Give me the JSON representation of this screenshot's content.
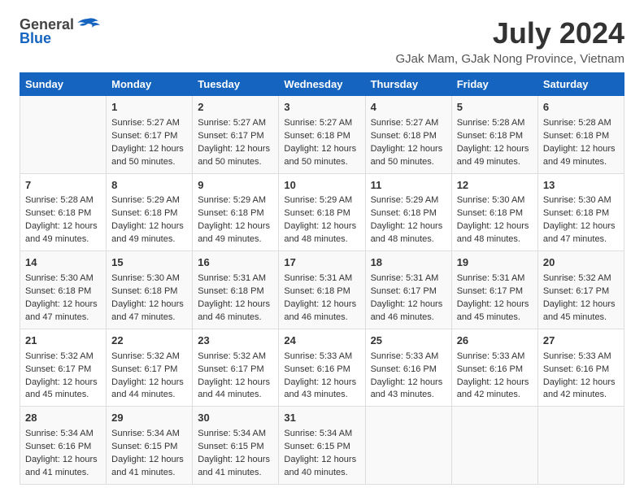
{
  "logo": {
    "general": "General",
    "blue": "Blue"
  },
  "title": "July 2024",
  "subtitle": "GJak Mam, GJak Nong Province, Vietnam",
  "columns": [
    "Sunday",
    "Monday",
    "Tuesday",
    "Wednesday",
    "Thursday",
    "Friday",
    "Saturday"
  ],
  "weeks": [
    [
      {
        "day": "",
        "info": ""
      },
      {
        "day": "1",
        "info": "Sunrise: 5:27 AM\nSunset: 6:17 PM\nDaylight: 12 hours\nand 50 minutes."
      },
      {
        "day": "2",
        "info": "Sunrise: 5:27 AM\nSunset: 6:17 PM\nDaylight: 12 hours\nand 50 minutes."
      },
      {
        "day": "3",
        "info": "Sunrise: 5:27 AM\nSunset: 6:18 PM\nDaylight: 12 hours\nand 50 minutes."
      },
      {
        "day": "4",
        "info": "Sunrise: 5:27 AM\nSunset: 6:18 PM\nDaylight: 12 hours\nand 50 minutes."
      },
      {
        "day": "5",
        "info": "Sunrise: 5:28 AM\nSunset: 6:18 PM\nDaylight: 12 hours\nand 49 minutes."
      },
      {
        "day": "6",
        "info": "Sunrise: 5:28 AM\nSunset: 6:18 PM\nDaylight: 12 hours\nand 49 minutes."
      }
    ],
    [
      {
        "day": "7",
        "info": "Sunrise: 5:28 AM\nSunset: 6:18 PM\nDaylight: 12 hours\nand 49 minutes."
      },
      {
        "day": "8",
        "info": "Sunrise: 5:29 AM\nSunset: 6:18 PM\nDaylight: 12 hours\nand 49 minutes."
      },
      {
        "day": "9",
        "info": "Sunrise: 5:29 AM\nSunset: 6:18 PM\nDaylight: 12 hours\nand 49 minutes."
      },
      {
        "day": "10",
        "info": "Sunrise: 5:29 AM\nSunset: 6:18 PM\nDaylight: 12 hours\nand 48 minutes."
      },
      {
        "day": "11",
        "info": "Sunrise: 5:29 AM\nSunset: 6:18 PM\nDaylight: 12 hours\nand 48 minutes."
      },
      {
        "day": "12",
        "info": "Sunrise: 5:30 AM\nSunset: 6:18 PM\nDaylight: 12 hours\nand 48 minutes."
      },
      {
        "day": "13",
        "info": "Sunrise: 5:30 AM\nSunset: 6:18 PM\nDaylight: 12 hours\nand 47 minutes."
      }
    ],
    [
      {
        "day": "14",
        "info": "Sunrise: 5:30 AM\nSunset: 6:18 PM\nDaylight: 12 hours\nand 47 minutes."
      },
      {
        "day": "15",
        "info": "Sunrise: 5:30 AM\nSunset: 6:18 PM\nDaylight: 12 hours\nand 47 minutes."
      },
      {
        "day": "16",
        "info": "Sunrise: 5:31 AM\nSunset: 6:18 PM\nDaylight: 12 hours\nand 46 minutes."
      },
      {
        "day": "17",
        "info": "Sunrise: 5:31 AM\nSunset: 6:18 PM\nDaylight: 12 hours\nand 46 minutes."
      },
      {
        "day": "18",
        "info": "Sunrise: 5:31 AM\nSunset: 6:17 PM\nDaylight: 12 hours\nand 46 minutes."
      },
      {
        "day": "19",
        "info": "Sunrise: 5:31 AM\nSunset: 6:17 PM\nDaylight: 12 hours\nand 45 minutes."
      },
      {
        "day": "20",
        "info": "Sunrise: 5:32 AM\nSunset: 6:17 PM\nDaylight: 12 hours\nand 45 minutes."
      }
    ],
    [
      {
        "day": "21",
        "info": "Sunrise: 5:32 AM\nSunset: 6:17 PM\nDaylight: 12 hours\nand 45 minutes."
      },
      {
        "day": "22",
        "info": "Sunrise: 5:32 AM\nSunset: 6:17 PM\nDaylight: 12 hours\nand 44 minutes."
      },
      {
        "day": "23",
        "info": "Sunrise: 5:32 AM\nSunset: 6:17 PM\nDaylight: 12 hours\nand 44 minutes."
      },
      {
        "day": "24",
        "info": "Sunrise: 5:33 AM\nSunset: 6:16 PM\nDaylight: 12 hours\nand 43 minutes."
      },
      {
        "day": "25",
        "info": "Sunrise: 5:33 AM\nSunset: 6:16 PM\nDaylight: 12 hours\nand 43 minutes."
      },
      {
        "day": "26",
        "info": "Sunrise: 5:33 AM\nSunset: 6:16 PM\nDaylight: 12 hours\nand 42 minutes."
      },
      {
        "day": "27",
        "info": "Sunrise: 5:33 AM\nSunset: 6:16 PM\nDaylight: 12 hours\nand 42 minutes."
      }
    ],
    [
      {
        "day": "28",
        "info": "Sunrise: 5:34 AM\nSunset: 6:16 PM\nDaylight: 12 hours\nand 41 minutes."
      },
      {
        "day": "29",
        "info": "Sunrise: 5:34 AM\nSunset: 6:15 PM\nDaylight: 12 hours\nand 41 minutes."
      },
      {
        "day": "30",
        "info": "Sunrise: 5:34 AM\nSunset: 6:15 PM\nDaylight: 12 hours\nand 41 minutes."
      },
      {
        "day": "31",
        "info": "Sunrise: 5:34 AM\nSunset: 6:15 PM\nDaylight: 12 hours\nand 40 minutes."
      },
      {
        "day": "",
        "info": ""
      },
      {
        "day": "",
        "info": ""
      },
      {
        "day": "",
        "info": ""
      }
    ]
  ]
}
